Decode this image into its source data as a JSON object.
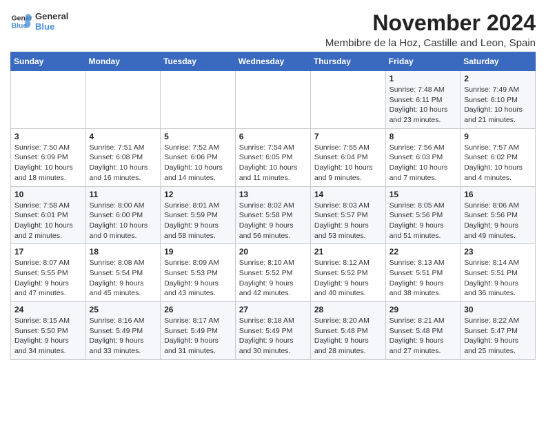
{
  "logo": {
    "line1": "General",
    "line2": "Blue"
  },
  "header": {
    "month": "November 2024",
    "location": "Membibre de la Hoz, Castille and Leon, Spain"
  },
  "weekdays": [
    "Sunday",
    "Monday",
    "Tuesday",
    "Wednesday",
    "Thursday",
    "Friday",
    "Saturday"
  ],
  "weeks": [
    [
      {
        "day": "",
        "info": ""
      },
      {
        "day": "",
        "info": ""
      },
      {
        "day": "",
        "info": ""
      },
      {
        "day": "",
        "info": ""
      },
      {
        "day": "",
        "info": ""
      },
      {
        "day": "1",
        "info": "Sunrise: 7:48 AM\nSunset: 6:11 PM\nDaylight: 10 hours and 23 minutes."
      },
      {
        "day": "2",
        "info": "Sunrise: 7:49 AM\nSunset: 6:10 PM\nDaylight: 10 hours and 21 minutes."
      }
    ],
    [
      {
        "day": "3",
        "info": "Sunrise: 7:50 AM\nSunset: 6:09 PM\nDaylight: 10 hours and 18 minutes."
      },
      {
        "day": "4",
        "info": "Sunrise: 7:51 AM\nSunset: 6:08 PM\nDaylight: 10 hours and 16 minutes."
      },
      {
        "day": "5",
        "info": "Sunrise: 7:52 AM\nSunset: 6:06 PM\nDaylight: 10 hours and 14 minutes."
      },
      {
        "day": "6",
        "info": "Sunrise: 7:54 AM\nSunset: 6:05 PM\nDaylight: 10 hours and 11 minutes."
      },
      {
        "day": "7",
        "info": "Sunrise: 7:55 AM\nSunset: 6:04 PM\nDaylight: 10 hours and 9 minutes."
      },
      {
        "day": "8",
        "info": "Sunrise: 7:56 AM\nSunset: 6:03 PM\nDaylight: 10 hours and 7 minutes."
      },
      {
        "day": "9",
        "info": "Sunrise: 7:57 AM\nSunset: 6:02 PM\nDaylight: 10 hours and 4 minutes."
      }
    ],
    [
      {
        "day": "10",
        "info": "Sunrise: 7:58 AM\nSunset: 6:01 PM\nDaylight: 10 hours and 2 minutes."
      },
      {
        "day": "11",
        "info": "Sunrise: 8:00 AM\nSunset: 6:00 PM\nDaylight: 10 hours and 0 minutes."
      },
      {
        "day": "12",
        "info": "Sunrise: 8:01 AM\nSunset: 5:59 PM\nDaylight: 9 hours and 58 minutes."
      },
      {
        "day": "13",
        "info": "Sunrise: 8:02 AM\nSunset: 5:58 PM\nDaylight: 9 hours and 56 minutes."
      },
      {
        "day": "14",
        "info": "Sunrise: 8:03 AM\nSunset: 5:57 PM\nDaylight: 9 hours and 53 minutes."
      },
      {
        "day": "15",
        "info": "Sunrise: 8:05 AM\nSunset: 5:56 PM\nDaylight: 9 hours and 51 minutes."
      },
      {
        "day": "16",
        "info": "Sunrise: 8:06 AM\nSunset: 5:56 PM\nDaylight: 9 hours and 49 minutes."
      }
    ],
    [
      {
        "day": "17",
        "info": "Sunrise: 8:07 AM\nSunset: 5:55 PM\nDaylight: 9 hours and 47 minutes."
      },
      {
        "day": "18",
        "info": "Sunrise: 8:08 AM\nSunset: 5:54 PM\nDaylight: 9 hours and 45 minutes."
      },
      {
        "day": "19",
        "info": "Sunrise: 8:09 AM\nSunset: 5:53 PM\nDaylight: 9 hours and 43 minutes."
      },
      {
        "day": "20",
        "info": "Sunrise: 8:10 AM\nSunset: 5:52 PM\nDaylight: 9 hours and 42 minutes."
      },
      {
        "day": "21",
        "info": "Sunrise: 8:12 AM\nSunset: 5:52 PM\nDaylight: 9 hours and 40 minutes."
      },
      {
        "day": "22",
        "info": "Sunrise: 8:13 AM\nSunset: 5:51 PM\nDaylight: 9 hours and 38 minutes."
      },
      {
        "day": "23",
        "info": "Sunrise: 8:14 AM\nSunset: 5:51 PM\nDaylight: 9 hours and 36 minutes."
      }
    ],
    [
      {
        "day": "24",
        "info": "Sunrise: 8:15 AM\nSunset: 5:50 PM\nDaylight: 9 hours and 34 minutes."
      },
      {
        "day": "25",
        "info": "Sunrise: 8:16 AM\nSunset: 5:49 PM\nDaylight: 9 hours and 33 minutes."
      },
      {
        "day": "26",
        "info": "Sunrise: 8:17 AM\nSunset: 5:49 PM\nDaylight: 9 hours and 31 minutes."
      },
      {
        "day": "27",
        "info": "Sunrise: 8:18 AM\nSunset: 5:49 PM\nDaylight: 9 hours and 30 minutes."
      },
      {
        "day": "28",
        "info": "Sunrise: 8:20 AM\nSunset: 5:48 PM\nDaylight: 9 hours and 28 minutes."
      },
      {
        "day": "29",
        "info": "Sunrise: 8:21 AM\nSunset: 5:48 PM\nDaylight: 9 hours and 27 minutes."
      },
      {
        "day": "30",
        "info": "Sunrise: 8:22 AM\nSunset: 5:47 PM\nDaylight: 9 hours and 25 minutes."
      }
    ]
  ]
}
